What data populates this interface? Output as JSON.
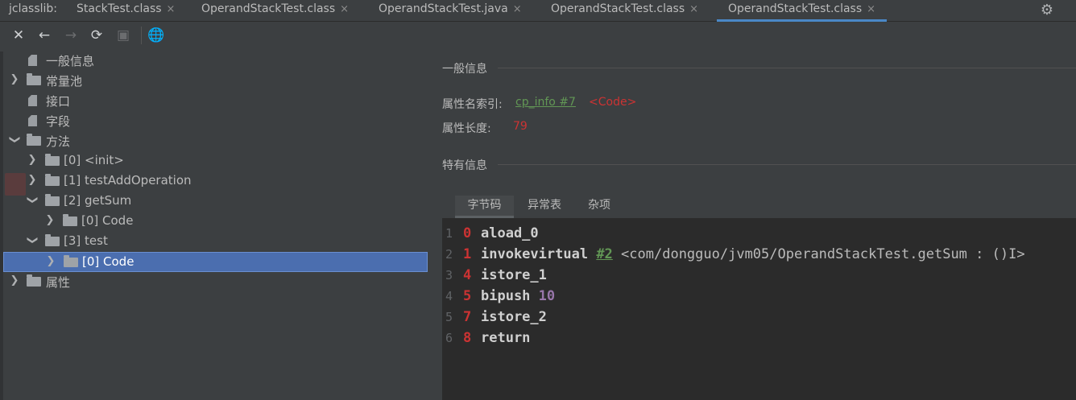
{
  "tabbar": {
    "prefix": "jclasslib:",
    "tabs": [
      {
        "label": "StackTest.class",
        "close": "×"
      },
      {
        "label": "OperandStackTest.class",
        "close": "×"
      },
      {
        "label": "OperandStackTest.java",
        "close": "×"
      },
      {
        "label": "OperandStackTest.class",
        "close": "×"
      },
      {
        "label": "OperandStackTest.class",
        "close": "×",
        "active": true
      }
    ],
    "settings_icon": "gear-icon"
  },
  "toolbar": {
    "buttons": [
      "close-icon",
      "back-icon",
      "forward-icon",
      "refresh-icon",
      "save-icon",
      "web-icon"
    ]
  },
  "tree": {
    "items": [
      {
        "label": "一般信息",
        "icon": "file"
      },
      {
        "label": "常量池",
        "icon": "folder",
        "expanded": false
      },
      {
        "label": "接口",
        "icon": "file"
      },
      {
        "label": "字段",
        "icon": "file"
      },
      {
        "label": "方法",
        "icon": "folder",
        "expanded": true
      },
      {
        "label": "[0] <init>",
        "icon": "folder",
        "expanded": false
      },
      {
        "label": "[1] testAddOperation",
        "icon": "folder",
        "expanded": false
      },
      {
        "label": "[2] getSum",
        "icon": "folder",
        "expanded": true
      },
      {
        "label": "[0] Code",
        "icon": "folder",
        "expanded": false
      },
      {
        "label": "[3] test",
        "icon": "folder",
        "expanded": true
      },
      {
        "label": "[0] Code",
        "icon": "folder",
        "expanded": false,
        "selected": true
      },
      {
        "label": "属性",
        "icon": "folder",
        "expanded": false
      }
    ]
  },
  "detail": {
    "general_title": "一般信息",
    "attr_name_index_label": "属性名索引:",
    "attr_name_index_link": "cp_info #7",
    "attr_name_index_value": "<Code>",
    "attr_length_label": "属性长度:",
    "attr_length_value": "79",
    "specific_title": "特有信息",
    "subtabs": [
      "字节码",
      "异常表",
      "杂项"
    ]
  },
  "bytecode": [
    {
      "line": "1",
      "offset": "0",
      "op": "aload_0"
    },
    {
      "line": "2",
      "offset": "1",
      "op": "invokevirtual",
      "ref": "#2",
      "comment": "<com/dongguo/jvm05/OperandStackTest.getSum : ()I>"
    },
    {
      "line": "3",
      "offset": "4",
      "op": "istore_1"
    },
    {
      "line": "4",
      "offset": "5",
      "op": "bipush",
      "num": "10"
    },
    {
      "line": "5",
      "offset": "7",
      "op": "istore_2"
    },
    {
      "line": "6",
      "offset": "8",
      "op": "return"
    }
  ],
  "colors": {
    "background": "#3c3f41",
    "code_background": "#2b2b2b",
    "selection": "#4b6eaf",
    "accent_tab": "#4a88c7",
    "link_green": "#629755",
    "value_red": "#cc3333",
    "number_purple": "#9876aa"
  }
}
